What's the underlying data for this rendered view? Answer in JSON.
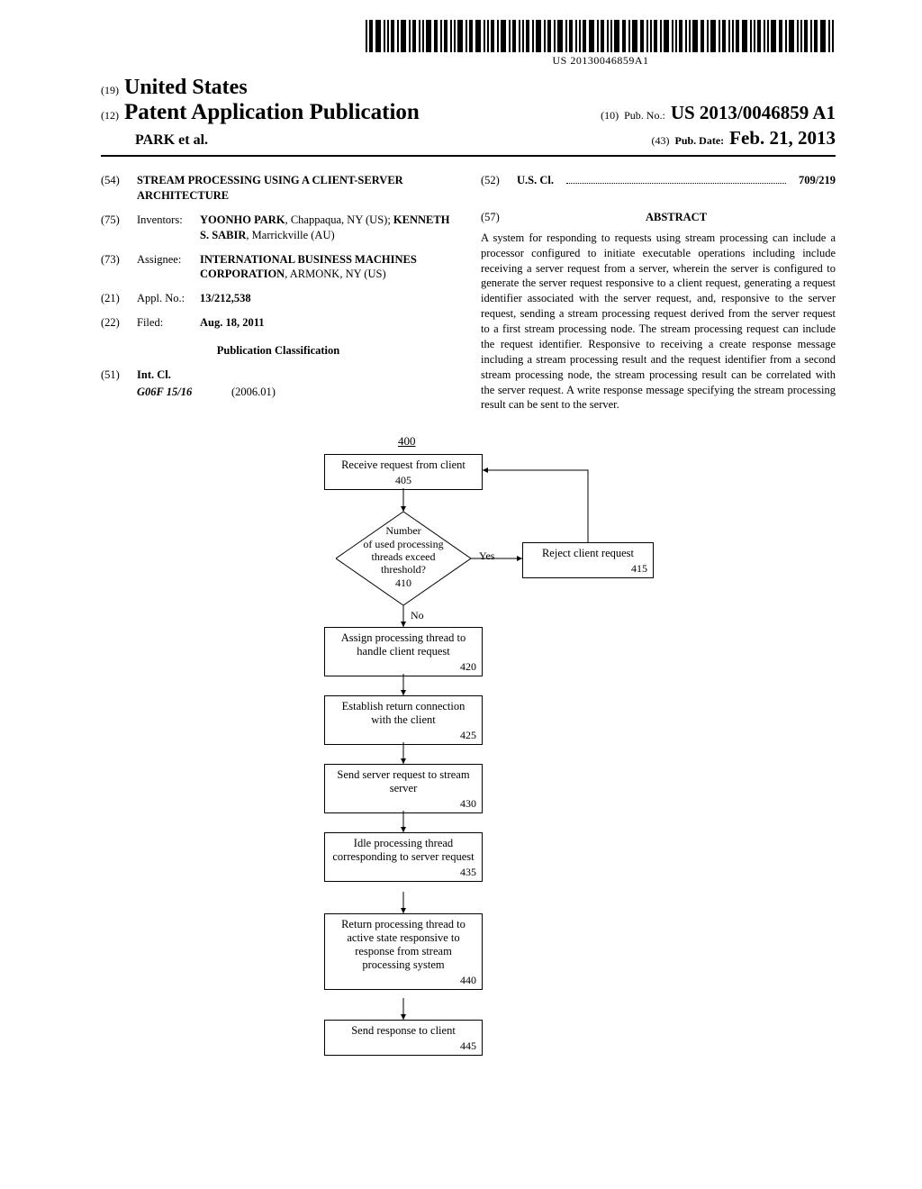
{
  "barcode_text": "US 20130046859A1",
  "header": {
    "country_code": "(19)",
    "country": "United States",
    "type_code": "(12)",
    "type": "Patent Application Publication",
    "authors": "PARK et al.",
    "pub_no_code": "(10)",
    "pub_no_label": "Pub. No.:",
    "pub_no": "US 2013/0046859 A1",
    "pub_date_code": "(43)",
    "pub_date_label": "Pub. Date:",
    "pub_date": "Feb. 21, 2013"
  },
  "left": {
    "title_code": "(54)",
    "title": "STREAM PROCESSING USING A CLIENT-SERVER ARCHITECTURE",
    "inventors_code": "(75)",
    "inventors_label": "Inventors:",
    "inventors_html": "YOONHO PARK, Chappaqua, NY (US); KENNETH S. SABIR, Marrickville (AU)",
    "inventor1_name": "YOONHO PARK",
    "inventor1_rest": ", Chappaqua, NY (US); ",
    "inventor2_name": "KENNETH S. SABIR",
    "inventor2_rest": ", Marrickville (AU)",
    "assignee_code": "(73)",
    "assignee_label": "Assignee:",
    "assignee_name": "INTERNATIONAL BUSINESS MACHINES CORPORATION",
    "assignee_rest": ", ARMONK, NY (US)",
    "appl_code": "(21)",
    "appl_label": "Appl. No.:",
    "appl_no": "13/212,538",
    "filed_code": "(22)",
    "filed_label": "Filed:",
    "filed_date": "Aug. 18, 2011",
    "pubclass": "Publication Classification",
    "intcl_code": "(51)",
    "intcl_label": "Int. Cl.",
    "intcl_class": "G06F 15/16",
    "intcl_date": "(2006.01)"
  },
  "right": {
    "uscl_code": "(52)",
    "uscl_label": "U.S. Cl.",
    "uscl_val": "709/219",
    "abstract_code": "(57)",
    "abstract_title": "ABSTRACT",
    "abstract_text": "A system for responding to requests using stream processing can include a processor configured to initiate executable operations including include receiving a server request from a server, wherein the server is configured to generate the server request responsive to a client request, generating a request identifier associated with the server request, and, responsive to the server request, sending a stream processing request derived from the server request to a first stream processing node. The stream processing request can include the request identifier. Responsive to receiving a create response message including a stream processing result and the request identifier from a second stream processing node, the stream processing result can be correlated with the server request. A write response message specifying the stream processing result can be sent to the server."
  },
  "flowchart": {
    "label": "400",
    "b405": "Receive request from client",
    "n405": "405",
    "d410_l1": "Number",
    "d410_l2": "of used processing",
    "d410_l3": "threads exceed",
    "d410_l4": "threshold?",
    "d410_n": "410",
    "yes": "Yes",
    "no": "No",
    "b415": "Reject client request",
    "n415": "415",
    "b420": "Assign processing thread to handle client request",
    "n420": "420",
    "b425": "Establish return connection with the client",
    "n425": "425",
    "b430": "Send server request to stream server",
    "n430": "430",
    "b435": "Idle processing thread corresponding to server request",
    "n435": "435",
    "b440": "Return processing thread to active state responsive to response from stream processing system",
    "n440": "440",
    "b445": "Send response to client",
    "n445": "445"
  }
}
